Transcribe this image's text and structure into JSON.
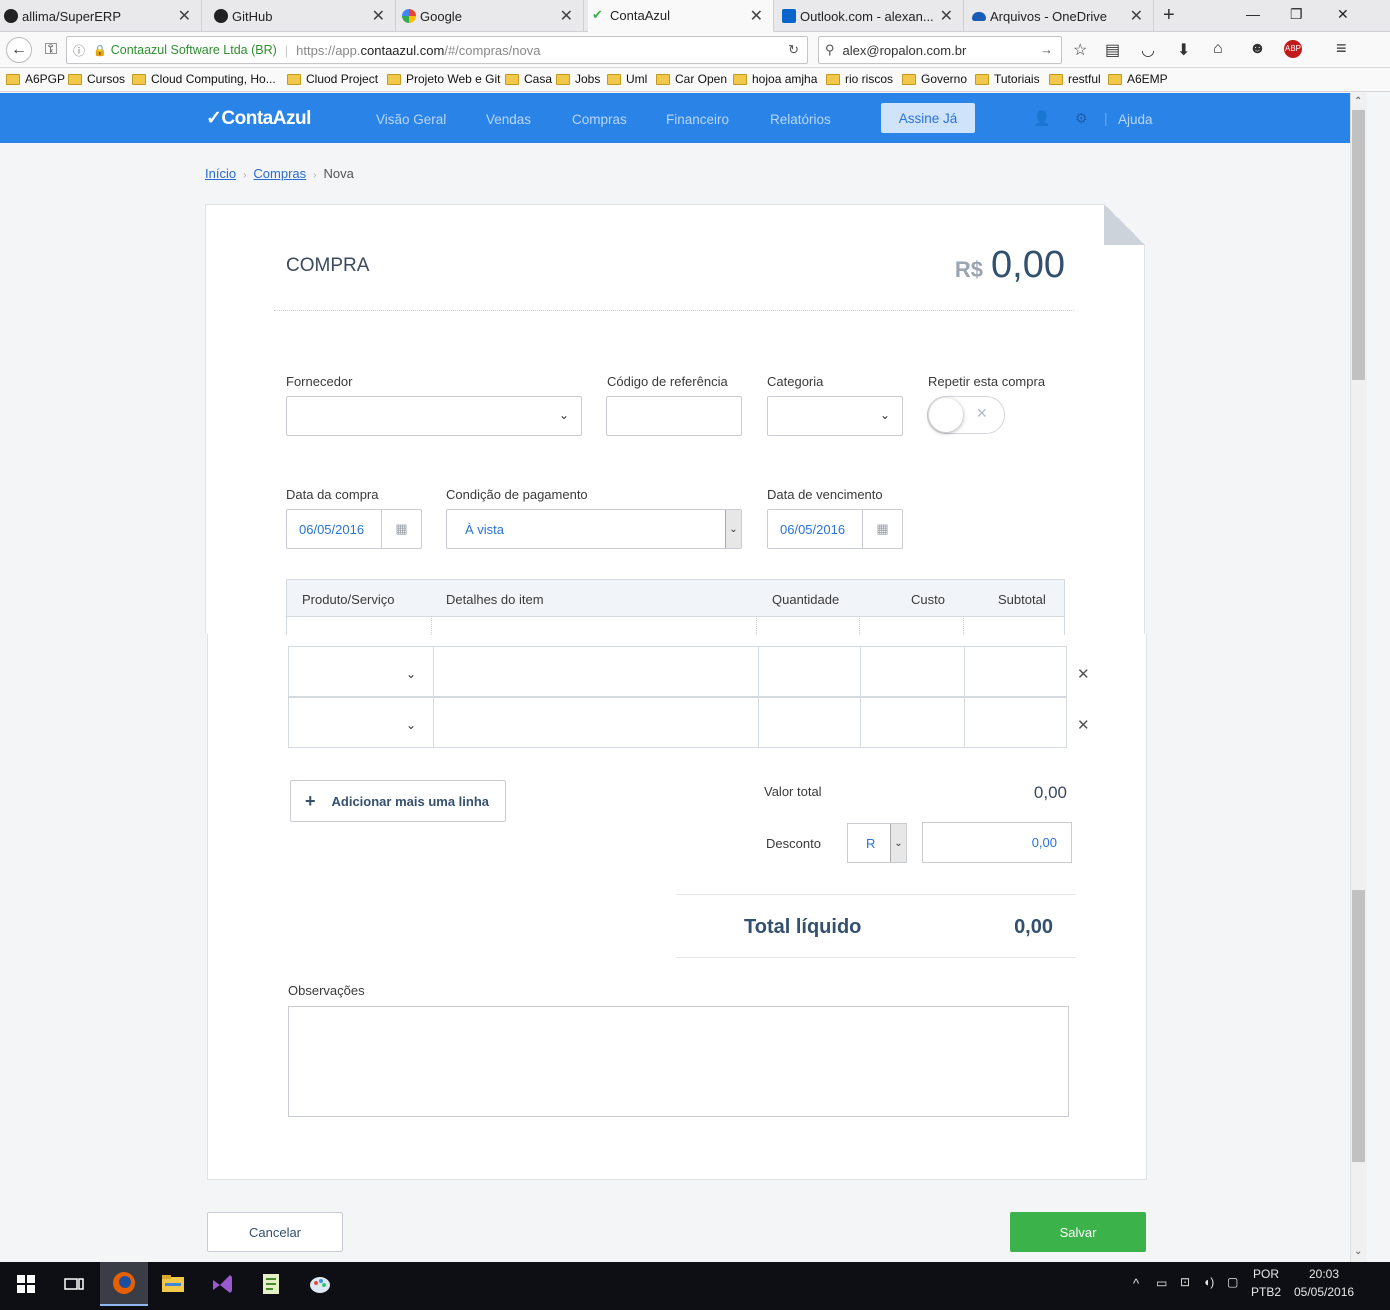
{
  "browser": {
    "tabs": [
      {
        "label": "allima/SuperERP",
        "icon": "github-icon"
      },
      {
        "label": "GitHub",
        "icon": "github-icon"
      },
      {
        "label": "Google",
        "icon": "google-icon"
      },
      {
        "label": "ContaAzul",
        "icon": "contaazul-icon"
      },
      {
        "label": "Outlook.com - alexan...",
        "icon": "outlook-icon"
      },
      {
        "label": "Arquivos - OneDrive",
        "icon": "onedrive-icon"
      }
    ],
    "site_identity": "Contaazul Software Ltda (BR)",
    "url_prefix": "https://app.",
    "url_domain": "contaazul.com",
    "url_path": "/#/compras/nova",
    "search_text": "alex@ropalon.com.br",
    "bookmarks": [
      "A6PGP",
      "Cursos",
      "Cloud Computing, Ho...",
      "Cluod Project",
      "Projeto Web e Git",
      "Casa",
      "Jobs",
      "Uml",
      "Car Open",
      "hojoa amjha",
      "rio riscos",
      "Governo",
      "Tutoriais",
      "restful",
      "A6EMP"
    ]
  },
  "app": {
    "logo": "ContaAzul",
    "nav": [
      "Visão Geral",
      "Vendas",
      "Compras",
      "Financeiro",
      "Relatórios"
    ],
    "cta": "Assine Já",
    "help": "Ajuda",
    "brand_color": "#2a83e6"
  },
  "breadcrumb": {
    "home": "Início",
    "section": "Compras",
    "current": "Nova"
  },
  "form": {
    "title": "COMPRA",
    "currency": "R$",
    "amount": "0,00",
    "fornecedor_label": "Fornecedor",
    "codigo_label": "Código de referência",
    "categoria_label": "Categoria",
    "repetir_label": "Repetir esta compra",
    "data_compra_label": "Data da compra",
    "data_compra": "06/05/2016",
    "condicao_label": "Condição de pagamento",
    "condicao": "À vista",
    "vencimento_label": "Data de vencimento",
    "vencimento": "06/05/2016"
  },
  "items_table": {
    "columns": [
      "Produto/Serviço",
      "Detalhes do item",
      "Quantidade",
      "Custo",
      "Subtotal"
    ],
    "rows": 2,
    "add_line": "Adicionar mais uma linha"
  },
  "totals": {
    "valor_total_label": "Valor total",
    "valor_total": "0,00",
    "desconto_label": "Desconto",
    "desconto_tipo": "R",
    "desconto_valor": "0,00",
    "total_liquido_label": "Total líquido",
    "total_liquido": "0,00"
  },
  "observacoes_label": "Observações",
  "actions": {
    "cancel": "Cancelar",
    "save": "Salvar",
    "save_color": "#3cb34a"
  },
  "taskbar": {
    "lang_top": "POR",
    "lang_bottom": "PTB2",
    "time": "20:03",
    "date": "05/05/2016"
  }
}
